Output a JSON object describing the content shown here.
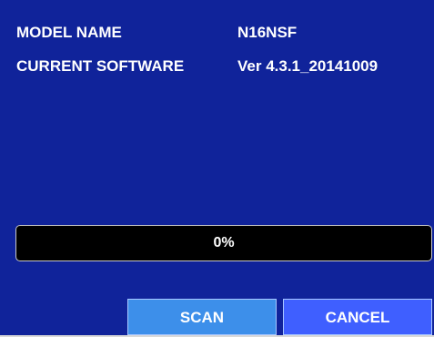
{
  "info": {
    "model_name_label": "MODEL NAME",
    "model_name_value": "N16NSF",
    "current_software_label": "CURRENT SOFTWARE",
    "current_software_value": "Ver 4.3.1_20141009"
  },
  "progress": {
    "percent": 0,
    "text": "0%"
  },
  "buttons": {
    "scan_label": "SCAN",
    "cancel_label": "CANCEL"
  },
  "colors": {
    "background": "#10239a",
    "progress_track": "#000000",
    "scan_button": "#3d8fea",
    "cancel_button": "#3f5fff",
    "text": "#ffffff"
  }
}
